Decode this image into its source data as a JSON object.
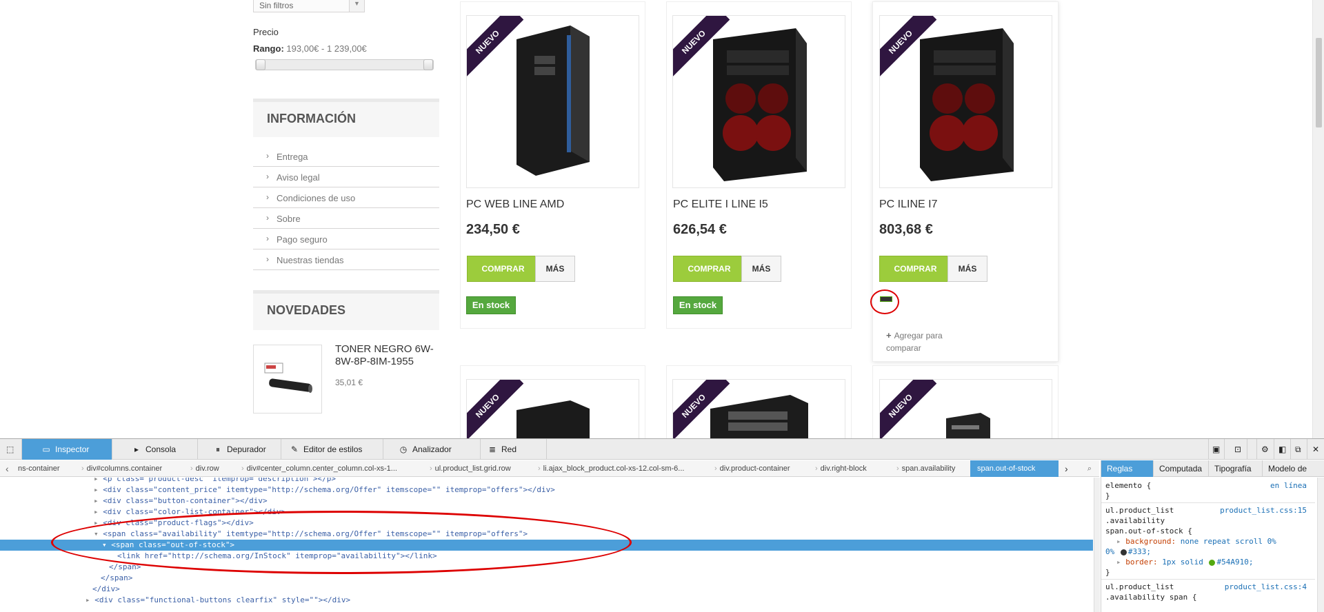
{
  "sidebar": {
    "filter_select_value": "Sin filtros",
    "price_label": "Precio",
    "range_label": "Rango:",
    "range_value": "193,00€ - 1 239,00€",
    "info_title": "INFORMACIÓN",
    "info_items": [
      "Entrega",
      "Aviso legal",
      "Condiciones de uso",
      "Sobre",
      "Pago seguro",
      "Nuestras tiendas"
    ],
    "news_title": "NOVEDADES",
    "news_product_name": "TONER NEGRO 6W-8W-8P-8IM-1955",
    "news_product_price": "35,01 €"
  },
  "products": [
    {
      "ribbon": "NUEVO",
      "name": "PC WEB LINE AMD",
      "price": "234,50 €",
      "buy": "COMPRAR",
      "more": "MÁS",
      "stock": "En stock"
    },
    {
      "ribbon": "NUEVO",
      "name": "PC ELITE I LINE I5",
      "price": "626,54 €",
      "buy": "COMPRAR",
      "more": "MÁS",
      "stock": "En stock"
    },
    {
      "ribbon": "NUEVO",
      "name": "PC ILINE I7",
      "price": "803,68 €",
      "buy": "COMPRAR",
      "more": "MÁS",
      "compare": "Agregar para comparar"
    }
  ],
  "products_row2": [
    {
      "ribbon": "NUEVO"
    },
    {
      "ribbon": "NUEVO"
    },
    {
      "ribbon": "NUEVO"
    }
  ],
  "devtools": {
    "tabs": [
      "Inspector",
      "Consola",
      "Depurador",
      "Editor de estilos",
      "Analizador",
      "Red"
    ],
    "breadcrumbs": [
      "ns-container",
      "div#columns.container",
      "div.row",
      "div#center_column.center_column.col-xs-1...",
      "ul.product_list.grid.row",
      "li.ajax_block_product.col-xs-12.col-sm-6...",
      "div.product-container",
      "div.right-block",
      "span.availability",
      "span.out-of-stock"
    ],
    "code_lines": [
      "<p class=\"product-desc\" itemprop=\"description\"></p>",
      "<div class=\"content_price\" itemtype=\"http://schema.org/Offer\" itemscope=\"\" itemprop=\"offers\"></div>",
      "<div class=\"button-container\"></div>",
      "<div class=\"color-list-container\"></div>",
      "<div class=\"product-flags\"></div>",
      "<span class=\"availability\" itemtype=\"http://schema.org/Offer\" itemscope=\"\" itemprop=\"offers\">",
      "<span class=\"out-of-stock\">",
      "<link href=\"http://schema.org/InStock\" itemprop=\"availability\"></link>",
      "</span>",
      "</span>",
      "</div>",
      "<div class=\"functional-buttons clearfix\" style=\"\"></div>"
    ],
    "rules_tabs": [
      "Reglas",
      "Computada",
      "Tipografía",
      "Modelo de caja"
    ],
    "rules": {
      "element_selector": "elemento {",
      "element_source": "en línea",
      "close": "}",
      "r1_sel1": "ul.product_list",
      "r1_sel2": ".availability",
      "r1_sel3": "span.out-of-stock {",
      "r1_source": "product_list.css:15",
      "r1_bg_prop": "background:",
      "r1_bg_val": "none repeat scroll 0%",
      "r1_bg_val2": "0%",
      "r1_bg_color": "#333;",
      "r1_border_prop": "border:",
      "r1_border_val": "1px solid",
      "r1_border_color": "#54A910;",
      "r2_sel1": "ul.product_list",
      "r2_sel2": ".availability span {",
      "r2_source": "product_list.css:4"
    }
  },
  "colors": {
    "buy_button": "#9ccc3c",
    "stock_badge": "#55a83e",
    "ribbon": "#2f1640",
    "devtools_accent": "#4c9ed9",
    "annotation": "#dd0000"
  }
}
